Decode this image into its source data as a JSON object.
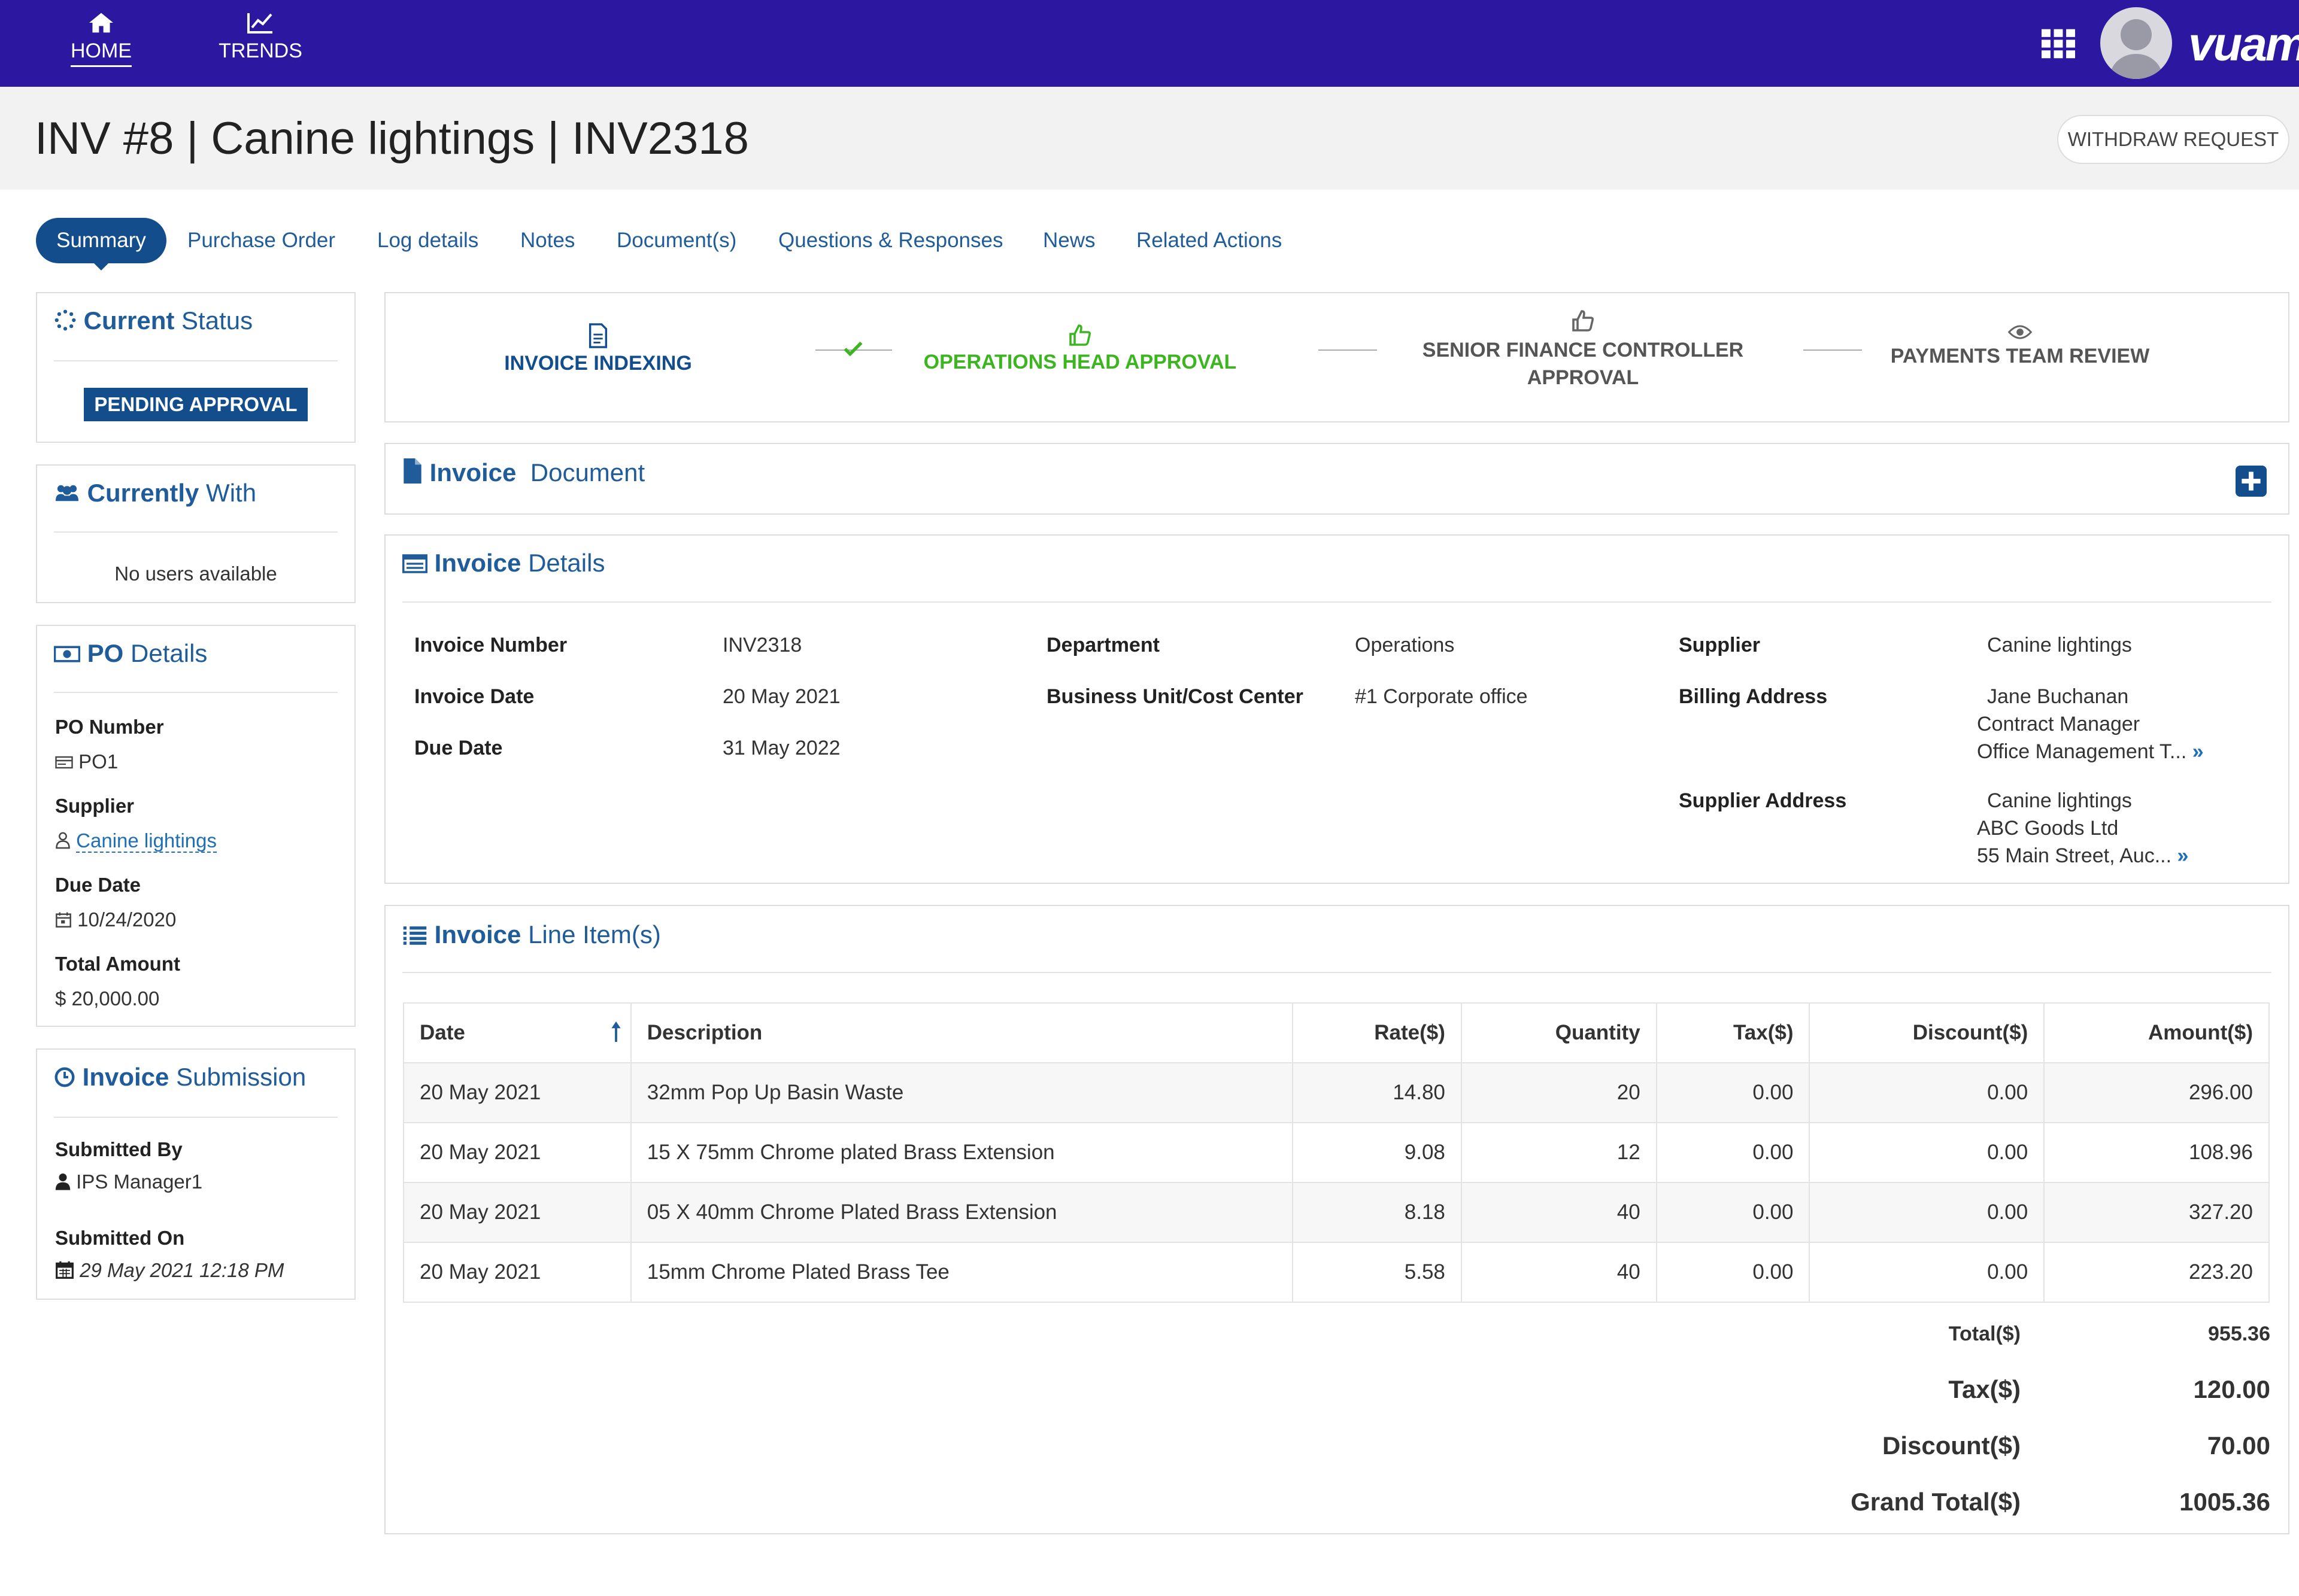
{
  "nav": {
    "home_label": "HOME",
    "trends_label": "TRENDS",
    "logo_text": "vuam"
  },
  "header": {
    "title": "INV #8 | Canine lightings | INV2318",
    "withdraw_label": "WITHDRAW REQUEST"
  },
  "tabs": [
    {
      "label": "Summary",
      "active": true
    },
    {
      "label": "Purchase Order"
    },
    {
      "label": "Log details"
    },
    {
      "label": "Notes"
    },
    {
      "label": "Document(s)"
    },
    {
      "label": "Questions & Responses"
    },
    {
      "label": "News"
    },
    {
      "label": "Related Actions"
    }
  ],
  "current_status": {
    "title_bold": "Current",
    "title_rest": "Status",
    "badge": "PENDING APPROVAL"
  },
  "currently_with": {
    "title_bold": "Currently",
    "title_rest": "With",
    "empty_text": "No users available"
  },
  "po_details": {
    "title_bold": "PO",
    "title_rest": "Details",
    "po_number_label": "PO Number",
    "po_number": "PO1",
    "supplier_label": "Supplier",
    "supplier": "Canine lightings",
    "due_date_label": "Due Date",
    "due_date": "10/24/2020",
    "total_label": "Total Amount",
    "total": "$ 20,000.00"
  },
  "submission": {
    "title_bold": "Invoice",
    "title_rest": "Submission",
    "submitted_by_label": "Submitted By",
    "submitted_by": "IPS Manager1",
    "submitted_on_label": "Submitted On",
    "submitted_on": "29 May 2021 12:18 PM"
  },
  "workflow": [
    {
      "label": "INVOICE INDEXING",
      "state": "current"
    },
    {
      "label": "OPERATIONS HEAD APPROVAL",
      "state": "approved"
    },
    {
      "label": "SENIOR FINANCE CONTROLLER",
      "label2": "APPROVAL",
      "state": "pending"
    },
    {
      "label": "PAYMENTS TEAM REVIEW",
      "state": "pending"
    }
  ],
  "colors": {
    "nav_bg": "#2b17a0",
    "accent": "#134d8c",
    "link": "#1f6fb5",
    "approved": "#3cb521"
  },
  "invoice_document": {
    "title_bold": "Invoice",
    "title_rest": "Document"
  },
  "invoice_details": {
    "title_bold": "Invoice",
    "title_rest": "Details",
    "invoice_number_label": "Invoice Number",
    "invoice_number": "INV2318",
    "invoice_date_label": "Invoice Date",
    "invoice_date": "20 May 2021",
    "due_date_label": "Due Date",
    "due_date": "31 May 2022",
    "department_label": "Department",
    "department": "Operations",
    "bu_label": "Business Unit/Cost Center",
    "bu": "#1 Corporate office",
    "supplier_label": "Supplier",
    "supplier": "Canine lightings",
    "billing_label": "Billing Address",
    "billing_line1": "Jane Buchanan",
    "billing_line2": "Contract Manager",
    "billing_line3": "Office Management T...",
    "supplier_address_label": "Supplier Address",
    "supplier_address_line1": "Canine lightings",
    "supplier_address_line2": "ABC Goods Ltd",
    "supplier_address_line3": "55 Main Street, Auc..."
  },
  "line_items": {
    "title_bold": "Invoice",
    "title_rest": "Line Item(s)",
    "headers": [
      "Date",
      "Description",
      "Rate($)",
      "Quantity",
      "Tax($)",
      "Discount($)",
      "Amount($)"
    ],
    "rows": [
      [
        "20 May 2021",
        "32mm Pop Up Basin Waste",
        "14.80",
        "20",
        "0.00",
        "0.00",
        "296.00"
      ],
      [
        "20 May 2021",
        "15 X 75mm Chrome plated Brass Extension",
        "9.08",
        "12",
        "0.00",
        "0.00",
        "108.96"
      ],
      [
        "20 May 2021",
        "05 X 40mm Chrome Plated Brass Extension",
        "8.18",
        "40",
        "0.00",
        "0.00",
        "327.20"
      ],
      [
        "20 May 2021",
        "15mm Chrome Plated Brass Tee",
        "5.58",
        "40",
        "0.00",
        "0.00",
        "223.20"
      ]
    ],
    "totals": {
      "total_label": "Total($)",
      "total": "955.36",
      "tax_label": "Tax($)",
      "tax": "120.00",
      "discount_label": "Discount($)",
      "discount": "70.00",
      "grand_label": "Grand Total($)",
      "grand": "1005.36"
    }
  }
}
